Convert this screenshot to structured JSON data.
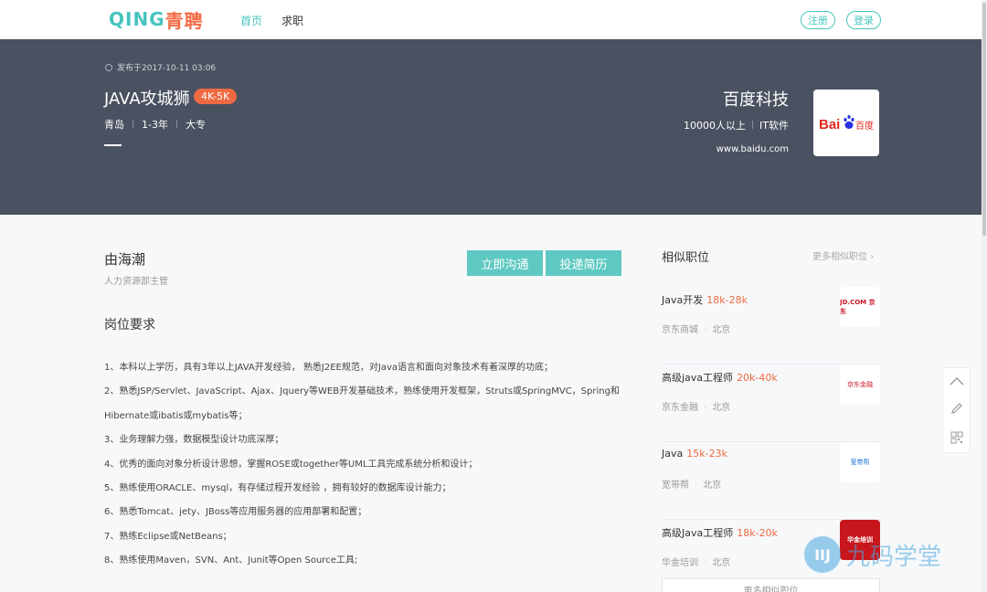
{
  "nav": {
    "logo_latin": "QING",
    "logo_cn": "青聘",
    "home": "首页",
    "jobs": "求职",
    "register": "注册",
    "login": "登录"
  },
  "job": {
    "published": "发布于2017-10-11 03:06",
    "title": "JAVA攻城狮",
    "salary": "4K-5K",
    "city": "青岛",
    "experience": "1-3年",
    "education": "大专"
  },
  "company": {
    "name": "百度科技",
    "size": "10000人以上",
    "industry": "IT软件",
    "website": "www.baidu.com",
    "logo_text": "Bai百度"
  },
  "recruiter": {
    "name": "由海潮",
    "role": "人力资源部主管",
    "chat_label": "立即沟通",
    "apply_label": "投递简历"
  },
  "requirements": {
    "title": "岗位要求",
    "items": [
      "1、本科以上学历，具有3年以上JAVA开发经验， 熟悉J2EE规范，对Java语言和面向对象技术有着深厚的功底；",
      "2、熟悉JSP/Servlet、JavaScript、Ajax、Jquery等WEB开发基础技术，熟练使用开发框架，Struts或SpringMVC，Spring和",
      "Hibernate或ibatis或mybatis等；",
      "3、业务理解力强，数据模型设计功底深厚；",
      "4、优秀的面向对象分析设计思想，掌握ROSE或together等UML工具完成系统分析和设计；",
      "5、熟练使用ORACLE、mysql，有存储过程开发经验 ，拥有较好的数据库设计能力；",
      "6、熟悉Tomcat、jety、JBoss等应用服务器的应用部署和配置；",
      "7、熟练Eclipse或NetBeans；",
      "8、熟练使用Maven，SVN、Ant、Junit等Open Source工具;"
    ]
  },
  "similar": {
    "title": "相似职位",
    "more": "更多相似职位",
    "more_bottom": "更多相似职位",
    "items": [
      {
        "title": "Java开发",
        "salary": "18k-28k",
        "company": "京东商城",
        "city": "北京",
        "logo": "JD.COM 京东"
      },
      {
        "title": "高级java工程师",
        "salary": "20k-40k",
        "company": "京东金融",
        "city": "北京",
        "logo": "京东金融"
      },
      {
        "title": "Java",
        "salary": "15k-23k",
        "company": "宽带帮",
        "city": "北京",
        "logo": "宽带帮"
      },
      {
        "title": "高级Java工程师",
        "salary": "18k-20k",
        "company": "华金培训",
        "city": "北京",
        "logo": "华金培训"
      }
    ]
  },
  "watermark": {
    "text": "九码学堂"
  }
}
